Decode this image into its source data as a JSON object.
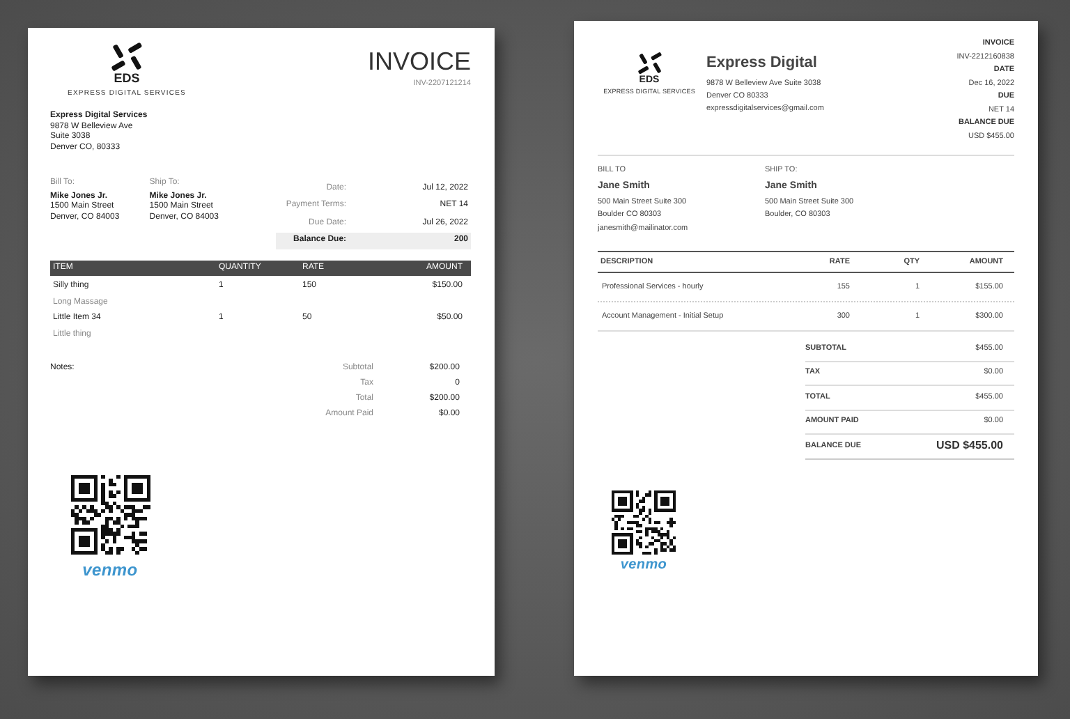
{
  "left_invoice": {
    "logo": {
      "initials": "EDS",
      "tagline": "EXPRESS DIGITAL SERVICES"
    },
    "title": "INVOICE",
    "number": "INV-2207121214",
    "company": {
      "name": "Express Digital Services",
      "lines": [
        "9878 W Belleview Ave",
        "Suite 3038",
        "Denver CO, 80333"
      ]
    },
    "bill_to": {
      "label": "Bill To:",
      "name": "Mike Jones Jr.",
      "lines": [
        "1500 Main Street",
        "Denver, CO 84003"
      ]
    },
    "ship_to": {
      "label": "Ship To:",
      "name": "Mike Jones Jr.",
      "lines": [
        "1500 Main Street",
        "Denver, CO 84003"
      ]
    },
    "meta": [
      {
        "label": "Date:",
        "value": "Jul 12, 2022",
        "kind": "plain"
      },
      {
        "label": "Payment Terms:",
        "value": "NET 14",
        "kind": "plain"
      },
      {
        "label": "Due Date:",
        "value": "Jul 26, 2022",
        "kind": "plain"
      },
      {
        "label": "Balance Due:",
        "value": "200",
        "kind": "highlight"
      }
    ],
    "table": {
      "columns": [
        "ITEM",
        "QUANTITY",
        "RATE",
        "AMOUNT"
      ],
      "rows": [
        {
          "item": "Silly thing",
          "description": "Long Massage",
          "quantity": "1",
          "rate": "150",
          "amount": "$150.00"
        },
        {
          "item": "Little Item 34",
          "description": "Little thing",
          "quantity": "1",
          "rate": "50",
          "amount": "$50.00"
        }
      ]
    },
    "notes_label": "Notes:",
    "totals": [
      {
        "label": "Subtotal",
        "value": "$200.00"
      },
      {
        "label": "Tax",
        "value": "0"
      },
      {
        "label": "Total",
        "value": "$200.00"
      },
      {
        "label": "Amount Paid",
        "value": "$0.00"
      }
    ],
    "payment": {
      "brand": "venmo"
    }
  },
  "right_invoice": {
    "logo": {
      "initials": "EDS",
      "tagline": "EXPRESS DIGITAL SERVICES"
    },
    "company": {
      "name": "Express Digital",
      "lines": [
        "9878 W Belleview Ave Suite 3038",
        "Denver CO 80333",
        "expressdigitalservices@gmail.com"
      ]
    },
    "meta": [
      {
        "label": "INVOICE",
        "value": "INV-2212160838"
      },
      {
        "label": "DATE",
        "value": "Dec 16, 2022"
      },
      {
        "label": "DUE",
        "value": "NET 14"
      },
      {
        "label": "BALANCE DUE",
        "value": "USD $455.00"
      }
    ],
    "bill_to": {
      "label": "BILL TO",
      "name": "Jane Smith",
      "lines": [
        "500 Main Street Suite 300",
        "Boulder CO 80303",
        "janesmith@mailinator.com"
      ]
    },
    "ship_to": {
      "label": "SHIP TO:",
      "name": "Jane Smith",
      "lines": [
        "500 Main Street Suite 300",
        "Boulder, CO 80303"
      ]
    },
    "table": {
      "columns": [
        "DESCRIPTION",
        "RATE",
        "QTY",
        "AMOUNT"
      ],
      "rows": [
        {
          "description": "Professional Services - hourly",
          "rate": "155",
          "qty": "1",
          "amount": "$155.00"
        },
        {
          "description": "Account Management - Initial Setup",
          "rate": "300",
          "qty": "1",
          "amount": "$300.00"
        }
      ]
    },
    "totals": [
      {
        "label": "SUBTOTAL",
        "value": "$455.00",
        "kind": "plain"
      },
      {
        "label": "TAX",
        "value": "$0.00",
        "kind": "plain"
      },
      {
        "label": "TOTAL",
        "value": "$455.00",
        "kind": "plain"
      },
      {
        "label": "AMOUNT PAID",
        "value": "$0.00",
        "kind": "plain"
      },
      {
        "label": "BALANCE DUE",
        "value": "USD $455.00",
        "kind": "emphasis"
      }
    ],
    "payment": {
      "brand": "venmo"
    }
  }
}
